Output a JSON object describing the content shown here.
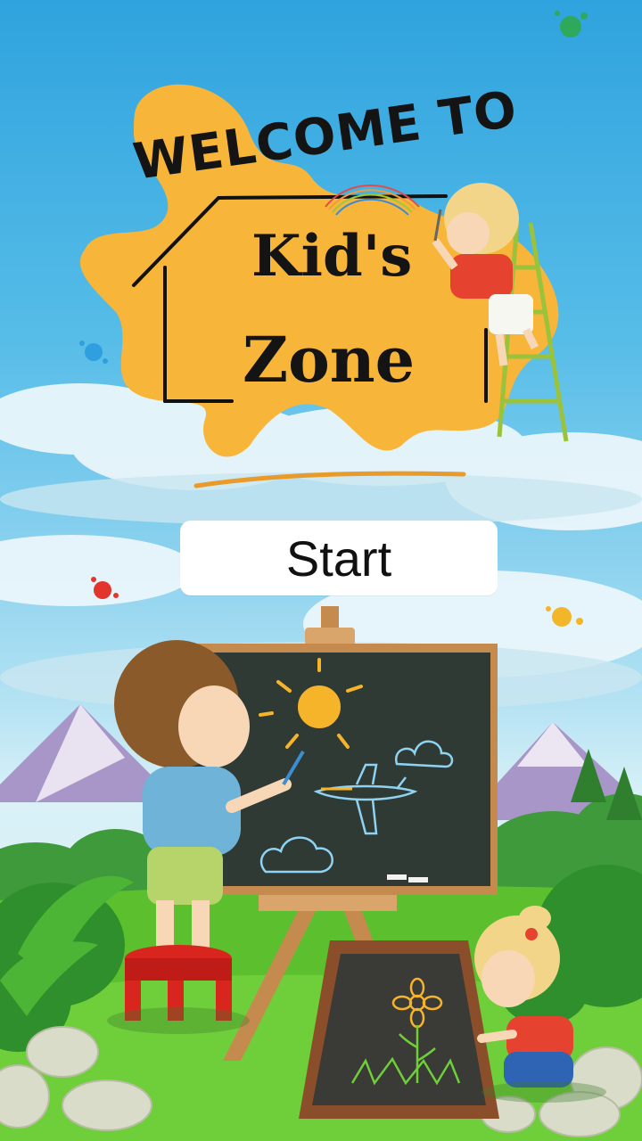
{
  "title": {
    "line1": "WELCOME TO",
    "line2": "Kid's",
    "line3": "Zone"
  },
  "start_button": {
    "label": "Start"
  },
  "colors": {
    "sky_top": "#2fa3de",
    "splash_orange": "#f7b53a",
    "grass": "#5cbf2d",
    "chalkboard": "#2f3a35"
  },
  "icons": [
    "paint-splash-icon",
    "rainbow-icon",
    "sun-drawing-icon",
    "flower-drawing-icon",
    "airplane-drawing-icon",
    "cloud-drawing-icon"
  ]
}
